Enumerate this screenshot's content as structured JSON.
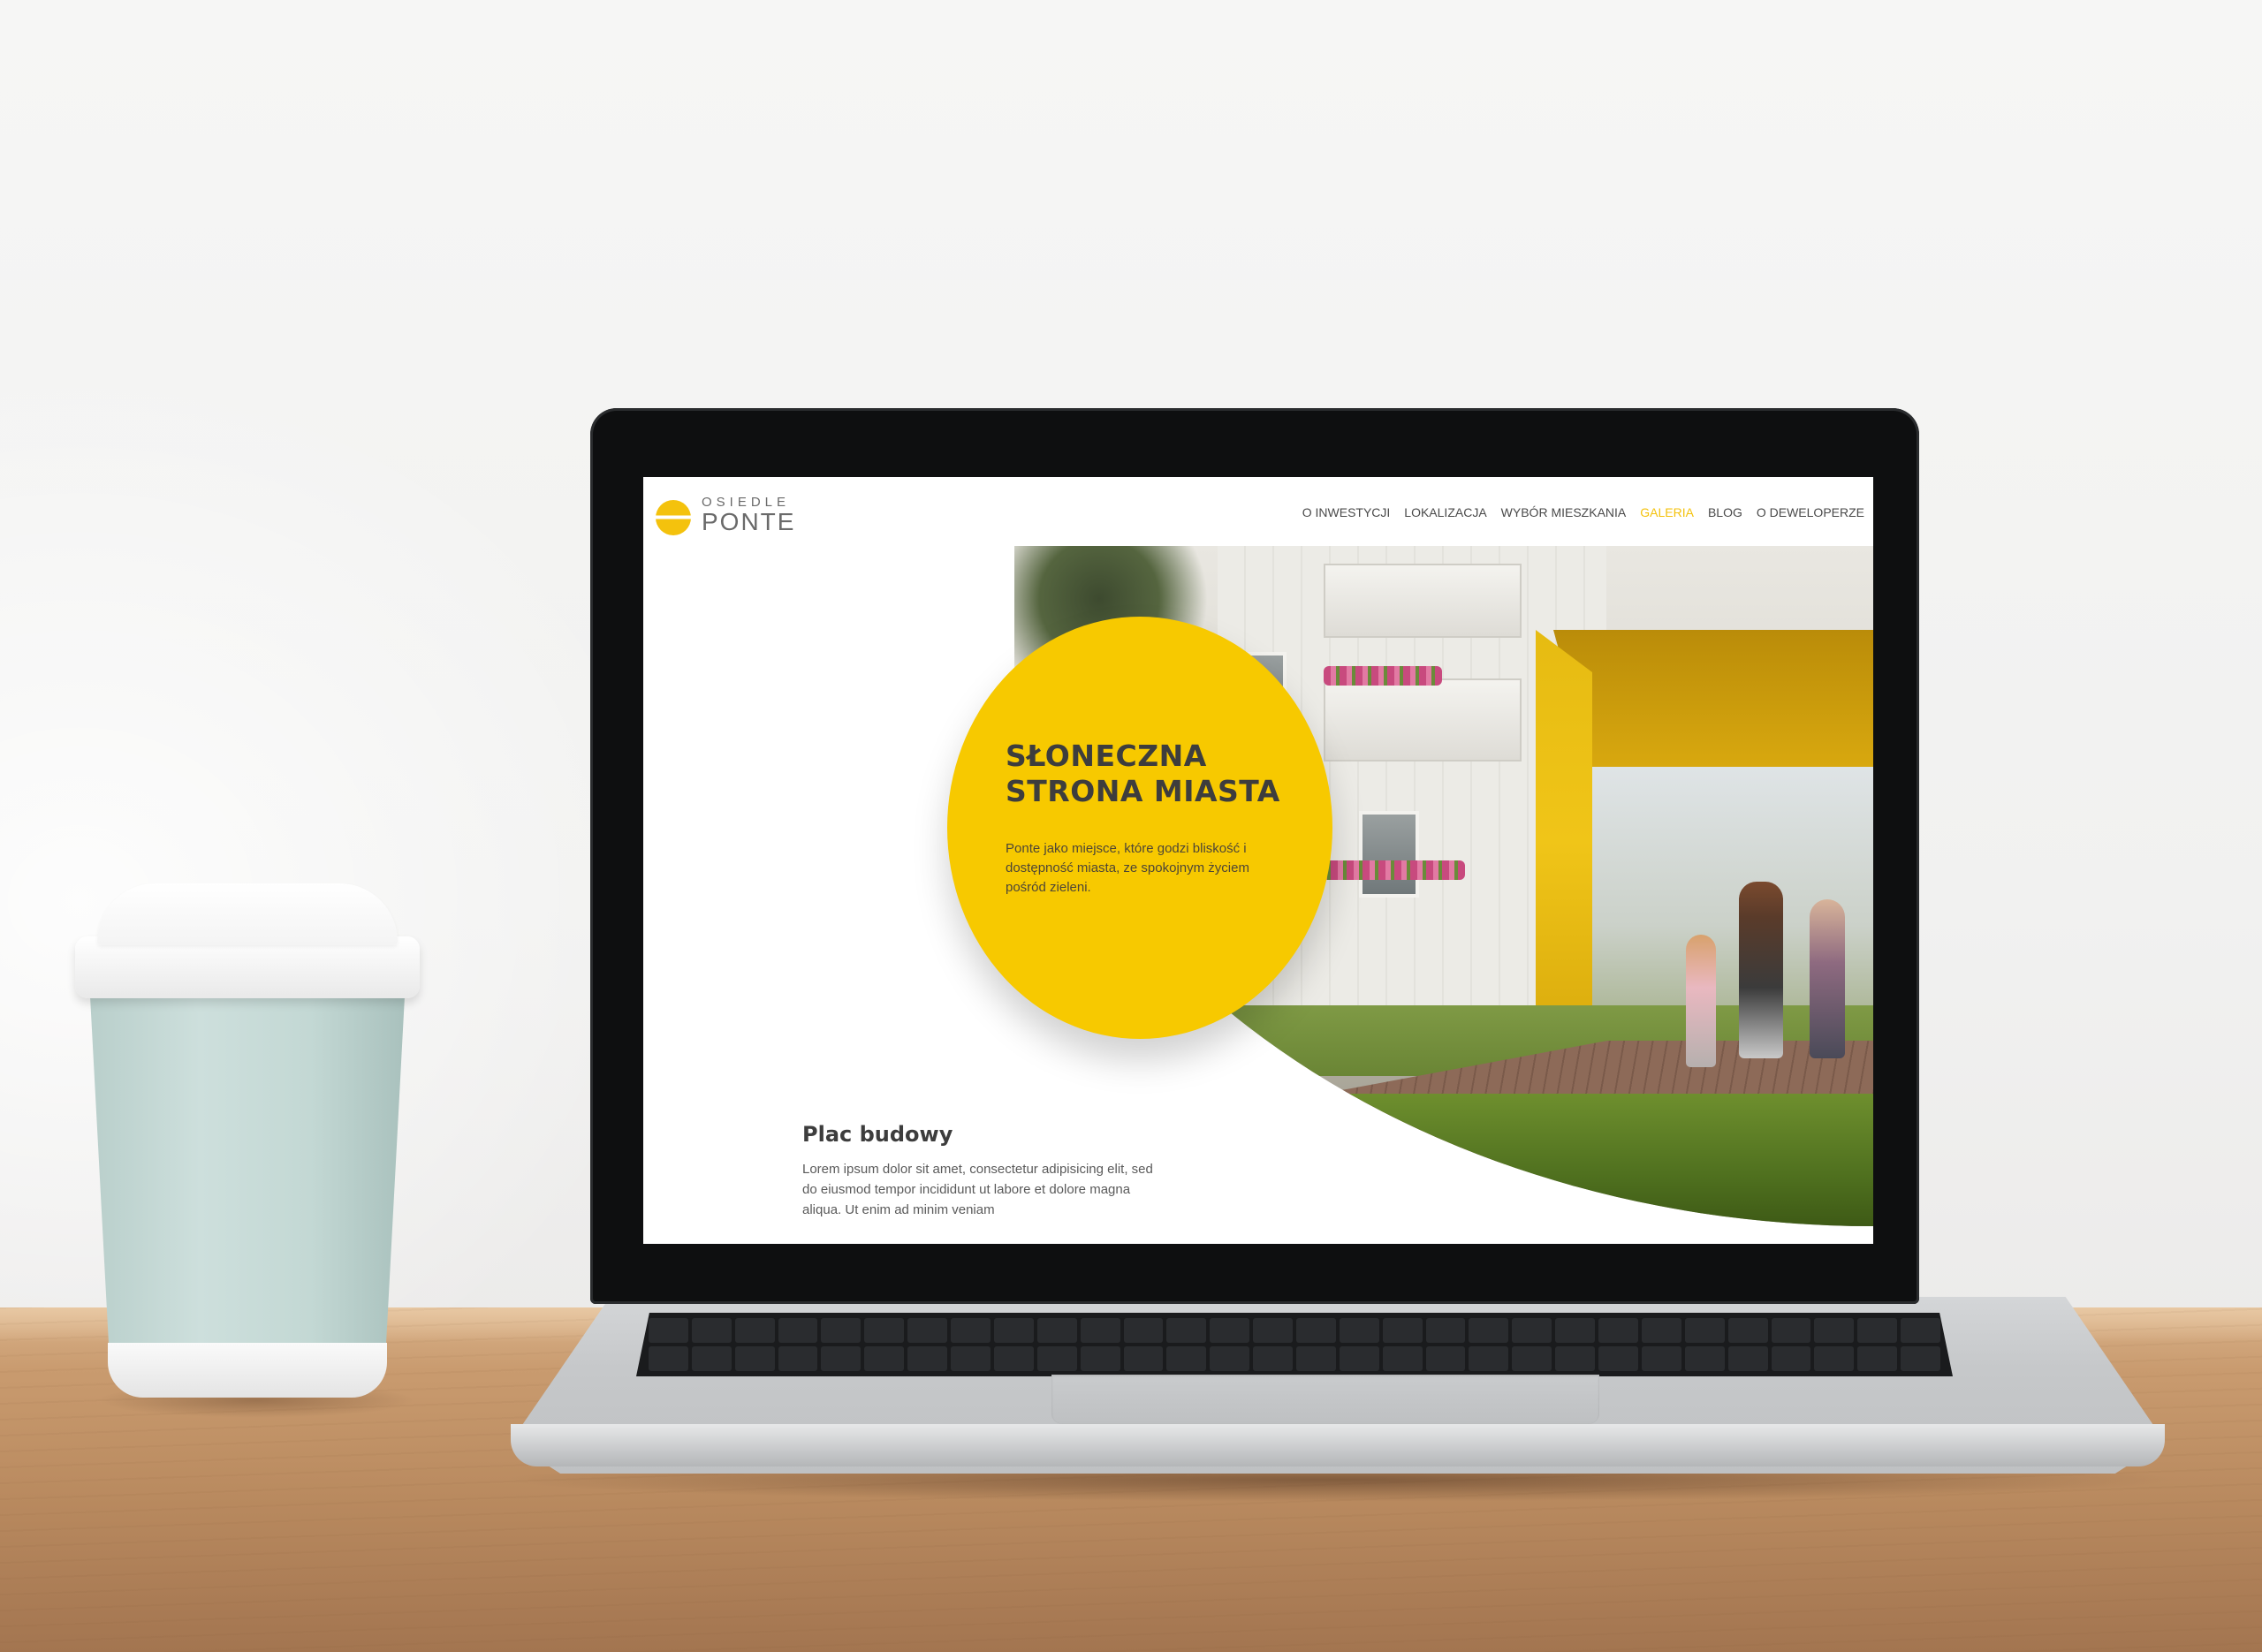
{
  "site": {
    "logo": {
      "top": "OSIEDLE",
      "bottom": "PONTE"
    },
    "nav": [
      {
        "label": "O INWESTYCJI",
        "active": false
      },
      {
        "label": "LOKALIZACJA",
        "active": false
      },
      {
        "label": "WYBÓR MIESZKANIA",
        "active": false
      },
      {
        "label": "GALERIA",
        "active": true
      },
      {
        "label": "BLOG",
        "active": false
      },
      {
        "label": "O DEWELOPERZE",
        "active": false
      }
    ],
    "hero": {
      "title_line1": "SŁONECZNA",
      "title_line2": "STRONA MIASTA",
      "text": "Ponte jako miejsce, które godzi bliskość i dostępność miasta, ze spokojnym życiem pośród zieleni."
    },
    "section": {
      "title": "Plac budowy",
      "text": "Lorem ipsum dolor sit amet, consectetur adipisicing elit, sed do eiusmod tempor incididunt ut labore et dolore magna aliqua. Ut enim ad minim veniam"
    }
  },
  "colors": {
    "accent": "#f7c900",
    "nav_active": "#f4c20d",
    "text_dark": "#3d3d3d"
  },
  "icons": {
    "logo_mark": "sun-icon"
  }
}
